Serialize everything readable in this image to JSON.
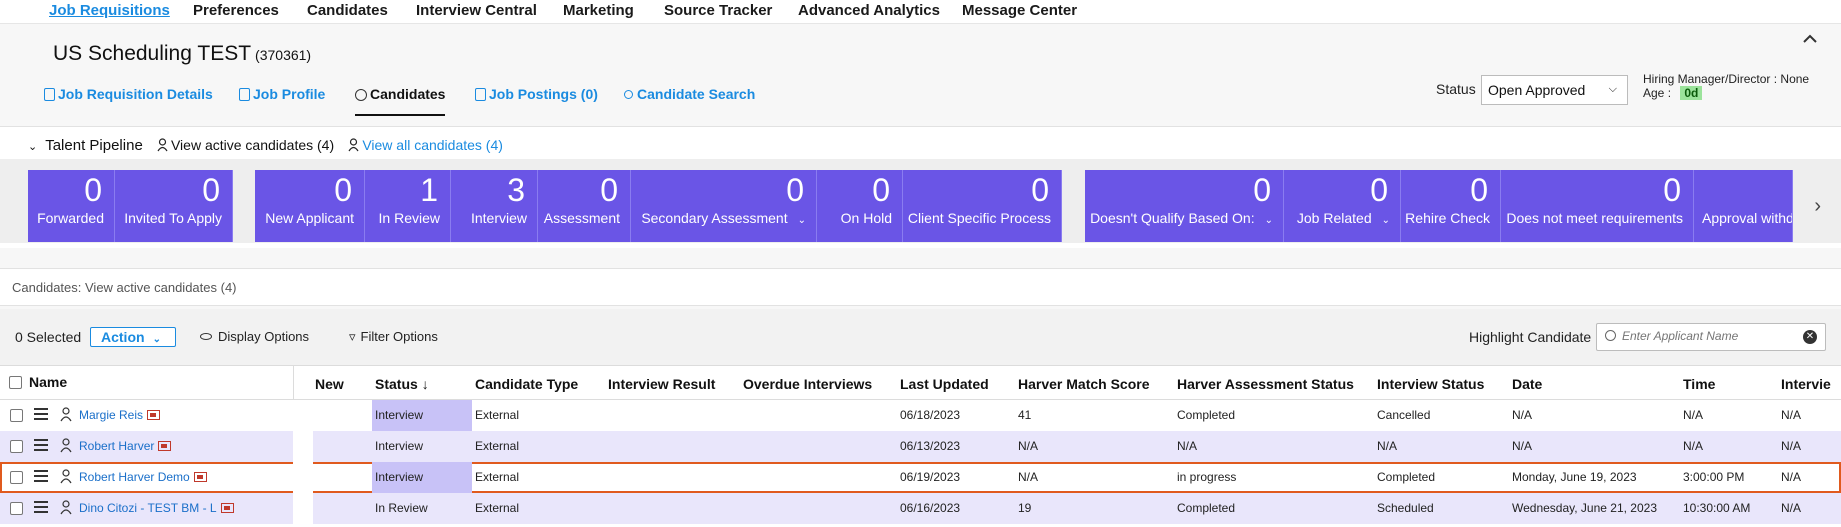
{
  "nav": {
    "items": [
      "Job Requisitions",
      "Preferences",
      "Candidates",
      "Interview Central",
      "Marketing",
      "Source Tracker",
      "Advanced Analytics",
      "Message Center"
    ],
    "active": "Job Requisitions"
  },
  "header": {
    "title": "US Scheduling TEST",
    "req_id": "(370361)",
    "tabs": [
      "Job Requisition Details",
      "Job Profile",
      "Candidates",
      "Job Postings (0)",
      "Candidate Search"
    ],
    "active_tab": "Candidates",
    "status_label": "Status",
    "status_value": "Open Approved",
    "hiring_manager_label": "Hiring Manager/Director",
    "hiring_manager_value": "None",
    "age_label": "Age",
    "age_value": "0d"
  },
  "pipeline": {
    "title": "Talent Pipeline",
    "view_active": "View active candidates (4)",
    "view_all": "View all candidates (4)",
    "tiles_group1": [
      {
        "count": "0",
        "label": "Forwarded"
      },
      {
        "count": "0",
        "label": "Invited To Apply"
      }
    ],
    "tiles_group2": [
      {
        "count": "0",
        "label": "New Applicant"
      },
      {
        "count": "1",
        "label": "In Review"
      },
      {
        "count": "3",
        "label": "Interview"
      },
      {
        "count": "0",
        "label": "Assessment"
      },
      {
        "count": "0",
        "label": "Secondary Assessment"
      },
      {
        "count": "0",
        "label": "On Hold"
      },
      {
        "count": "0",
        "label": "Client Specific Process"
      }
    ],
    "tiles_group3": [
      {
        "count": "0",
        "label": "Doesn't Qualify Based On:"
      },
      {
        "count": "0",
        "label": "Job Related"
      },
      {
        "count": "0",
        "label": "Rehire Check"
      },
      {
        "count": "0",
        "label": "Does not meet requirements"
      },
      {
        "count": "",
        "label": "Approval withd"
      }
    ]
  },
  "candidates": {
    "section_title": "Candidates: View active candidates (4)",
    "selected": "0 Selected",
    "action_label": "Action",
    "display_options": "Display Options",
    "filter_options": "Filter Options",
    "highlight_label": "Highlight Candidate",
    "search_placeholder": "Enter Applicant Name"
  },
  "table": {
    "columns": [
      "Name",
      "New",
      "Status",
      "Candidate Type",
      "Interview Result",
      "Overdue Interviews",
      "Last Updated",
      "Harver Match Score",
      "Harver Assessment Status",
      "Interview Status",
      "Date",
      "Time",
      "Intervie"
    ],
    "rows": [
      {
        "name": "Margie Reis",
        "new": "",
        "status": "Interview",
        "type": "External",
        "result": "",
        "overdue": "",
        "updated": "06/18/2023",
        "score": "41",
        "assessment": "Completed",
        "istatus": "Cancelled",
        "date": "N/A",
        "time": "N/A",
        "interviewer": "N/A"
      },
      {
        "name": "Robert Harver",
        "new": "",
        "status": "Interview",
        "type": "External",
        "result": "",
        "overdue": "",
        "updated": "06/13/2023",
        "score": "N/A",
        "assessment": "N/A",
        "istatus": "N/A",
        "date": "N/A",
        "time": "N/A",
        "interviewer": "N/A"
      },
      {
        "name": "Robert Harver Demo",
        "new": "",
        "status": "Interview",
        "type": "External",
        "result": "",
        "overdue": "",
        "updated": "06/19/2023",
        "score": "N/A",
        "assessment": "in progress",
        "istatus": "Completed",
        "date": "Monday, June 19, 2023",
        "time": "3:00:00 PM",
        "interviewer": "N/A"
      },
      {
        "name": "Dino Citozi - TEST BM - L",
        "new": "",
        "status": "In Review",
        "type": "External",
        "result": "",
        "overdue": "",
        "updated": "06/16/2023",
        "score": "19",
        "assessment": "Completed",
        "istatus": "Scheduled",
        "date": "Wednesday, June 21, 2023",
        "time": "10:30:00 AM",
        "interviewer": "N/A"
      }
    ],
    "highlighted_row": 2
  },
  "colors": {
    "tile": "#6a55e6",
    "link": "#1a8be0",
    "row_alt": "#e9e6fb",
    "highlight": "#e05a1e"
  }
}
